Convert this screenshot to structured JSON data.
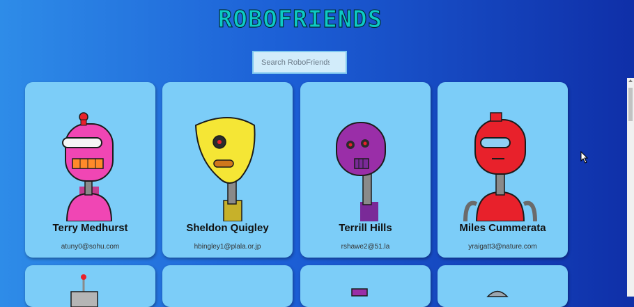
{
  "app": {
    "title": "ROBOFRIENDS",
    "search_placeholder": "Search RoboFriends"
  },
  "cards": [
    {
      "name": "Terry Medhurst",
      "email": "atuny0@sohu.com",
      "robot_color": "#f046b4"
    },
    {
      "name": "Sheldon Quigley",
      "email": "hbingley1@plala.or.jp",
      "robot_color": "#f5e635"
    },
    {
      "name": "Terrill Hills",
      "email": "rshawe2@51.la",
      "robot_color": "#9a2ea8"
    },
    {
      "name": "Miles Cummerata",
      "email": "yraigatt3@nature.com",
      "robot_color": "#e8212b"
    }
  ],
  "colors": {
    "card_bg": "#7ccdf8",
    "title": "#0ccac4"
  }
}
